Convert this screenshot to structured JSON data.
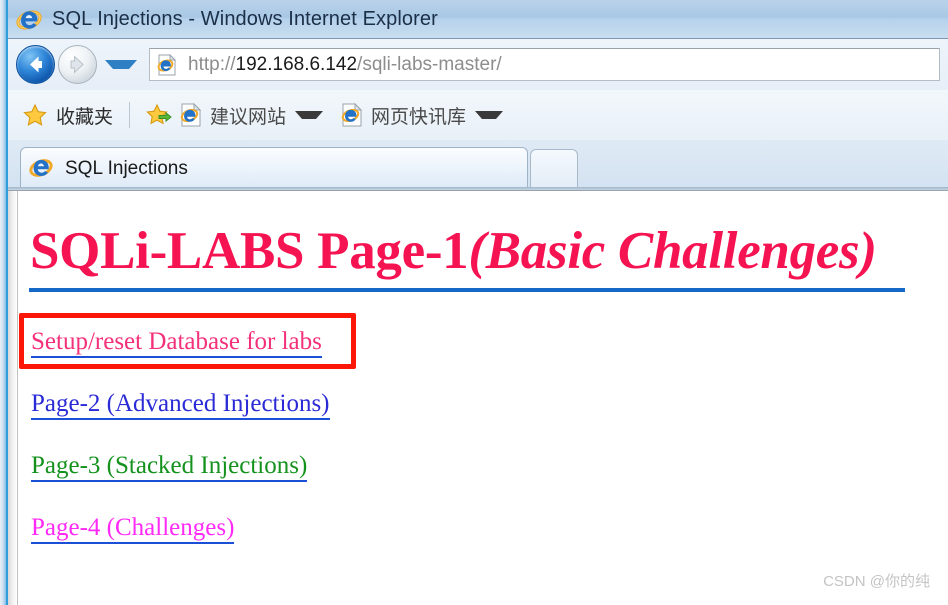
{
  "window": {
    "title": "SQL Injections - Windows Internet Explorer",
    "app_icon": "ie-logo-icon"
  },
  "navigation": {
    "back_icon": "back-arrow-icon",
    "forward_icon": "forward-arrow-icon",
    "recent_pages_icon": "chevron-down-icon",
    "address": {
      "page_icon": "page-document-icon",
      "scheme": "http://",
      "host": "192.168.6.142",
      "path": "/sqli-labs-master/",
      "full_url": "http://192.168.6.142/sqli-labs-master/"
    }
  },
  "favorites_bar": {
    "favorites_button": {
      "icon": "star-icon",
      "label": "收藏夹"
    },
    "add_favorite_icon": "star-add-icon",
    "items": [
      {
        "icon": "page-ie-icon",
        "label": "建议网站",
        "caret": "caret-down-icon"
      },
      {
        "icon": "page-ie-icon",
        "label": "网页快讯库",
        "caret": "caret-down-icon"
      }
    ]
  },
  "tabs": {
    "active": {
      "icon": "ie-logo-icon",
      "label": "SQL Injections"
    },
    "new_tab_label": ""
  },
  "page": {
    "heading": {
      "main": "SQLi-LABS Page-1",
      "italic": "(Basic Challenges)",
      "color": "#f51352",
      "rule_color": "#1569c7"
    },
    "links": [
      {
        "label": "Setup/reset Database for labs",
        "color": "#f4307a",
        "underline_color": "#1a4fd6"
      },
      {
        "label": "Page-2 (Advanced Injections)",
        "color": "#2a2ad6",
        "underline_color": "#1a4fd6"
      },
      {
        "label": "Page-3 (Stacked Injections)",
        "color": "#15921d",
        "underline_color": "#1a4fd6"
      },
      {
        "label": "Page-4 (Challenges)",
        "color": "#ff2af5",
        "underline_color": "#1a4fd6"
      }
    ],
    "annotation": {
      "target": "Setup/reset Database for labs",
      "color": "#fb1607"
    },
    "watermark": "CSDN @你的纯"
  }
}
